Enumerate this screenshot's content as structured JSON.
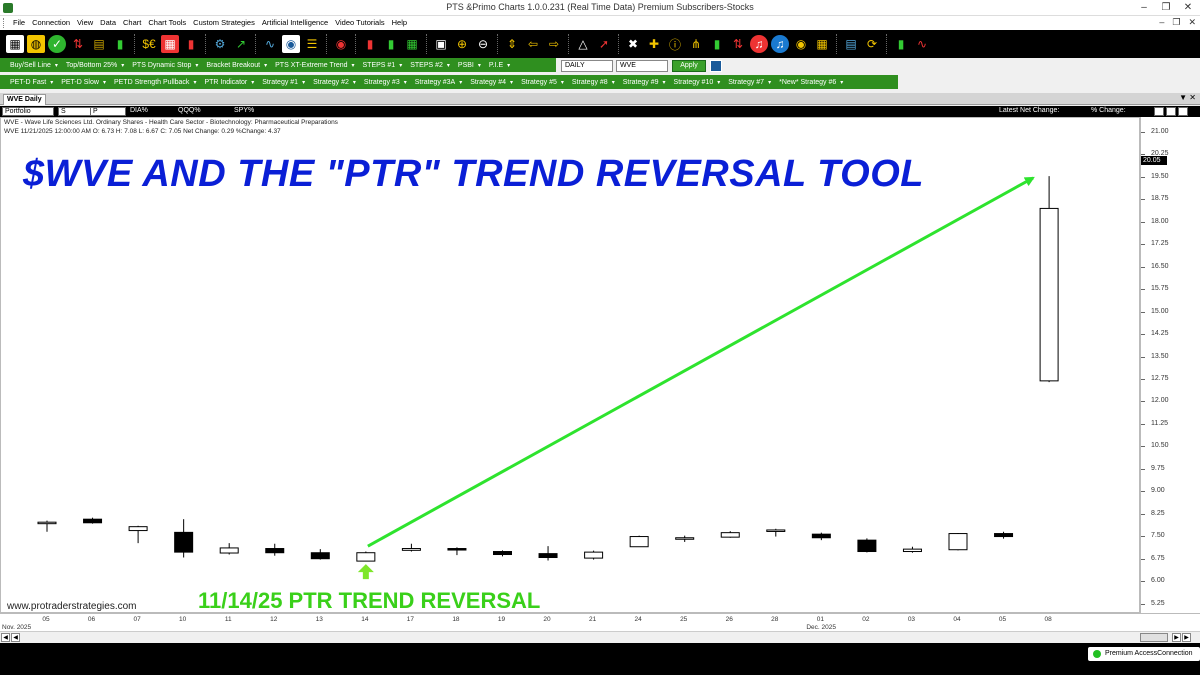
{
  "window": {
    "title": "PTS &Primo Charts 1.0.0.231  (Real Time Data) Premium Subscribers-Stocks"
  },
  "menu": {
    "items": [
      "File",
      "Connection",
      "View",
      "Data",
      "Chart",
      "Chart Tools",
      "Custom Strategies",
      "Artificial Intelligence",
      "Video Tutorials",
      "Help"
    ]
  },
  "strategy_row1": [
    "Buy/Sell Line",
    "Top/Bottom 25%",
    "PTS Dynamic Stop",
    "Bracket Breakout",
    "PTS XT-Extreme Trend",
    "STEPS #1",
    "STEPS #2",
    "PSBI",
    "P.I.E"
  ],
  "strategy_row2": [
    "PET-D Fast",
    "PET-D Slow",
    "PETD Strength Pullback",
    "PTR Indicator",
    "Strategy #1",
    "Strategy #2",
    "Strategy #3",
    "Strategy #3A",
    "Strategy #4",
    "Strategy #5",
    "Strategy #8",
    "Strategy #9",
    "Strategy #10",
    "Strategy #7",
    "*New* Strategy #6"
  ],
  "controls": {
    "period": "DAILY",
    "symbol": "WVE",
    "apply_label": "Apply"
  },
  "doc_tab": "WVE Daily",
  "watchlist": {
    "portfolio_label": "Portfolio",
    "s_label": "S",
    "p_label": "P",
    "dia_label": "DIA%",
    "qqq_label": "QQQ%",
    "spy_label": "SPY%",
    "latest_change_label": "Latest Net Change:",
    "pct_change_label": "% Change:"
  },
  "chart_header": {
    "company": "WVE - Wave Life Sciences Ltd. Ordinary Shares - Health Care Sector - Biotechnology: Pharmaceutical Preparations",
    "quote": "WVE 11/21/2025 12:00:00 AM O: 6.73 H: 7.08 L: 6.67 C: 7.05 Net Change: 0.29  %Change: 4.37"
  },
  "headline": "$WVE AND THE \"PTR\" TREND REVERSAL TOOL",
  "annotation": "11/14/25 PTR TREND REVERSAL",
  "website": "www.protraderstrategies.com",
  "last_price_tag": "20.05",
  "status": {
    "connection": "Premium AccessConnection"
  },
  "colors": {
    "headline": "#0a1fd6",
    "annotation": "#3ad01a",
    "strategy_bar": "#2f8f1f"
  },
  "chart_data": {
    "type": "candlestick",
    "ylim": [
      5.0,
      21.5
    ],
    "yticks": [
      "21.00",
      "20.25",
      "19.50",
      "18.75",
      "18.00",
      "17.25",
      "16.50",
      "15.75",
      "15.00",
      "14.25",
      "13.50",
      "12.75",
      "12.00",
      "11.25",
      "10.50",
      "9.75",
      "9.00",
      "8.25",
      "7.50",
      "6.75",
      "6.00",
      "5.25"
    ],
    "x_labels": [
      "05",
      "06",
      "07",
      "10",
      "11",
      "12",
      "13",
      "14",
      "17",
      "18",
      "19",
      "20",
      "21",
      "24",
      "25",
      "26",
      "28",
      "01",
      "02",
      "03",
      "04",
      "05",
      "08"
    ],
    "month_labels": [
      {
        "at": 0,
        "text": "Nov. 2025"
      },
      {
        "at": 17,
        "text": "Dec. 2025"
      }
    ],
    "candles": [
      {
        "o": 7.98,
        "h": 8.05,
        "l": 7.68,
        "c": 8.0
      },
      {
        "o": 8.1,
        "h": 8.15,
        "l": 7.95,
        "c": 7.98
      },
      {
        "o": 7.72,
        "h": 7.88,
        "l": 7.3,
        "c": 7.85
      },
      {
        "o": 7.66,
        "h": 8.1,
        "l": 6.82,
        "c": 7.0
      },
      {
        "o": 6.97,
        "h": 7.3,
        "l": 6.92,
        "c": 7.14
      },
      {
        "o": 7.12,
        "h": 7.28,
        "l": 6.88,
        "c": 6.98
      },
      {
        "o": 6.98,
        "h": 7.1,
        "l": 6.75,
        "c": 6.78
      },
      {
        "o": 6.7,
        "h": 7.02,
        "l": 6.7,
        "c": 6.98
      },
      {
        "o": 7.06,
        "h": 7.28,
        "l": 7.02,
        "c": 7.12
      },
      {
        "o": 7.12,
        "h": 7.16,
        "l": 6.9,
        "c": 7.08
      },
      {
        "o": 7.02,
        "h": 7.06,
        "l": 6.86,
        "c": 6.92
      },
      {
        "o": 6.95,
        "h": 7.2,
        "l": 6.72,
        "c": 6.82
      },
      {
        "o": 6.8,
        "h": 7.05,
        "l": 6.75,
        "c": 7.0
      },
      {
        "o": 7.18,
        "h": 7.55,
        "l": 7.18,
        "c": 7.52
      },
      {
        "o": 7.44,
        "h": 7.55,
        "l": 7.34,
        "c": 7.48
      },
      {
        "o": 7.5,
        "h": 7.7,
        "l": 7.48,
        "c": 7.65
      },
      {
        "o": 7.72,
        "h": 7.78,
        "l": 7.52,
        "c": 7.74
      },
      {
        "o": 7.6,
        "h": 7.65,
        "l": 7.4,
        "c": 7.48
      },
      {
        "o": 7.4,
        "h": 7.46,
        "l": 6.99,
        "c": 7.02
      },
      {
        "o": 7.02,
        "h": 7.18,
        "l": 6.98,
        "c": 7.1
      },
      {
        "o": 7.08,
        "h": 7.64,
        "l": 7.06,
        "c": 7.62
      },
      {
        "o": 7.62,
        "h": 7.68,
        "l": 7.45,
        "c": 7.52
      },
      {
        "o": 12.72,
        "h": 19.56,
        "l": 12.68,
        "c": 18.48
      }
    ],
    "arrow": {
      "from_index": 7,
      "to_index": 22,
      "from_price": 7.2,
      "to_price": 19.5
    },
    "marker_index": 7
  }
}
